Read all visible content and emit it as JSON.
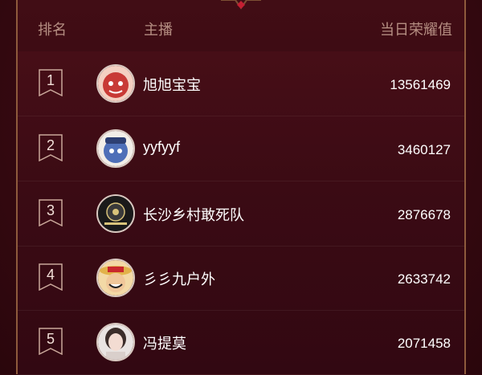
{
  "header": {
    "rank_label": "排名",
    "host_label": "主播",
    "value_label": "当日荣耀值"
  },
  "rows": [
    {
      "rank": "1",
      "name": "旭旭宝宝",
      "value": "13561469",
      "avatar": "red-cartoon-avatar"
    },
    {
      "rank": "2",
      "name": "yyfyyf",
      "value": "3460127",
      "avatar": "blue-cartoon-avatar"
    },
    {
      "rank": "3",
      "name": "长沙乡村敢死队",
      "value": "2876678",
      "avatar": "team-logo-avatar"
    },
    {
      "rank": "4",
      "name": "彡彡九户外",
      "value": "2633742",
      "avatar": "straw-hat-avatar"
    },
    {
      "rank": "5",
      "name": "冯提莫",
      "value": "2071458",
      "avatar": "portrait-avatar"
    }
  ],
  "colors": {
    "background": "#3b0b14",
    "header_text": "#b58e82",
    "accent": "#d4283a",
    "border": "#8e5a3c"
  }
}
